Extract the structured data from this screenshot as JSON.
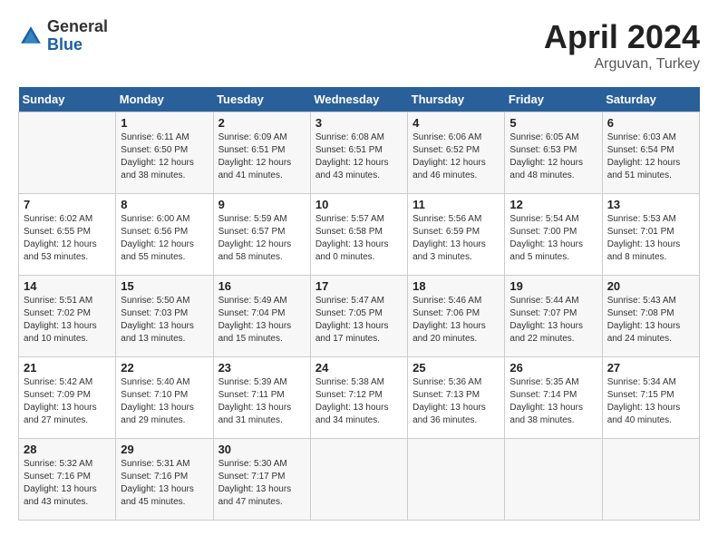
{
  "header": {
    "logo": {
      "general": "General",
      "blue": "Blue"
    },
    "title": "April 2024",
    "location": "Arguvan, Turkey"
  },
  "weekdays": [
    "Sunday",
    "Monday",
    "Tuesday",
    "Wednesday",
    "Thursday",
    "Friday",
    "Saturday"
  ],
  "weeks": [
    [
      {
        "day": "",
        "sunrise": "",
        "sunset": "",
        "daylight": ""
      },
      {
        "day": "1",
        "sunrise": "Sunrise: 6:11 AM",
        "sunset": "Sunset: 6:50 PM",
        "daylight": "Daylight: 12 hours and 38 minutes."
      },
      {
        "day": "2",
        "sunrise": "Sunrise: 6:09 AM",
        "sunset": "Sunset: 6:51 PM",
        "daylight": "Daylight: 12 hours and 41 minutes."
      },
      {
        "day": "3",
        "sunrise": "Sunrise: 6:08 AM",
        "sunset": "Sunset: 6:51 PM",
        "daylight": "Daylight: 12 hours and 43 minutes."
      },
      {
        "day": "4",
        "sunrise": "Sunrise: 6:06 AM",
        "sunset": "Sunset: 6:52 PM",
        "daylight": "Daylight: 12 hours and 46 minutes."
      },
      {
        "day": "5",
        "sunrise": "Sunrise: 6:05 AM",
        "sunset": "Sunset: 6:53 PM",
        "daylight": "Daylight: 12 hours and 48 minutes."
      },
      {
        "day": "6",
        "sunrise": "Sunrise: 6:03 AM",
        "sunset": "Sunset: 6:54 PM",
        "daylight": "Daylight: 12 hours and 51 minutes."
      }
    ],
    [
      {
        "day": "7",
        "sunrise": "Sunrise: 6:02 AM",
        "sunset": "Sunset: 6:55 PM",
        "daylight": "Daylight: 12 hours and 53 minutes."
      },
      {
        "day": "8",
        "sunrise": "Sunrise: 6:00 AM",
        "sunset": "Sunset: 6:56 PM",
        "daylight": "Daylight: 12 hours and 55 minutes."
      },
      {
        "day": "9",
        "sunrise": "Sunrise: 5:59 AM",
        "sunset": "Sunset: 6:57 PM",
        "daylight": "Daylight: 12 hours and 58 minutes."
      },
      {
        "day": "10",
        "sunrise": "Sunrise: 5:57 AM",
        "sunset": "Sunset: 6:58 PM",
        "daylight": "Daylight: 13 hours and 0 minutes."
      },
      {
        "day": "11",
        "sunrise": "Sunrise: 5:56 AM",
        "sunset": "Sunset: 6:59 PM",
        "daylight": "Daylight: 13 hours and 3 minutes."
      },
      {
        "day": "12",
        "sunrise": "Sunrise: 5:54 AM",
        "sunset": "Sunset: 7:00 PM",
        "daylight": "Daylight: 13 hours and 5 minutes."
      },
      {
        "day": "13",
        "sunrise": "Sunrise: 5:53 AM",
        "sunset": "Sunset: 7:01 PM",
        "daylight": "Daylight: 13 hours and 8 minutes."
      }
    ],
    [
      {
        "day": "14",
        "sunrise": "Sunrise: 5:51 AM",
        "sunset": "Sunset: 7:02 PM",
        "daylight": "Daylight: 13 hours and 10 minutes."
      },
      {
        "day": "15",
        "sunrise": "Sunrise: 5:50 AM",
        "sunset": "Sunset: 7:03 PM",
        "daylight": "Daylight: 13 hours and 13 minutes."
      },
      {
        "day": "16",
        "sunrise": "Sunrise: 5:49 AM",
        "sunset": "Sunset: 7:04 PM",
        "daylight": "Daylight: 13 hours and 15 minutes."
      },
      {
        "day": "17",
        "sunrise": "Sunrise: 5:47 AM",
        "sunset": "Sunset: 7:05 PM",
        "daylight": "Daylight: 13 hours and 17 minutes."
      },
      {
        "day": "18",
        "sunrise": "Sunrise: 5:46 AM",
        "sunset": "Sunset: 7:06 PM",
        "daylight": "Daylight: 13 hours and 20 minutes."
      },
      {
        "day": "19",
        "sunrise": "Sunrise: 5:44 AM",
        "sunset": "Sunset: 7:07 PM",
        "daylight": "Daylight: 13 hours and 22 minutes."
      },
      {
        "day": "20",
        "sunrise": "Sunrise: 5:43 AM",
        "sunset": "Sunset: 7:08 PM",
        "daylight": "Daylight: 13 hours and 24 minutes."
      }
    ],
    [
      {
        "day": "21",
        "sunrise": "Sunrise: 5:42 AM",
        "sunset": "Sunset: 7:09 PM",
        "daylight": "Daylight: 13 hours and 27 minutes."
      },
      {
        "day": "22",
        "sunrise": "Sunrise: 5:40 AM",
        "sunset": "Sunset: 7:10 PM",
        "daylight": "Daylight: 13 hours and 29 minutes."
      },
      {
        "day": "23",
        "sunrise": "Sunrise: 5:39 AM",
        "sunset": "Sunset: 7:11 PM",
        "daylight": "Daylight: 13 hours and 31 minutes."
      },
      {
        "day": "24",
        "sunrise": "Sunrise: 5:38 AM",
        "sunset": "Sunset: 7:12 PM",
        "daylight": "Daylight: 13 hours and 34 minutes."
      },
      {
        "day": "25",
        "sunrise": "Sunrise: 5:36 AM",
        "sunset": "Sunset: 7:13 PM",
        "daylight": "Daylight: 13 hours and 36 minutes."
      },
      {
        "day": "26",
        "sunrise": "Sunrise: 5:35 AM",
        "sunset": "Sunset: 7:14 PM",
        "daylight": "Daylight: 13 hours and 38 minutes."
      },
      {
        "day": "27",
        "sunrise": "Sunrise: 5:34 AM",
        "sunset": "Sunset: 7:15 PM",
        "daylight": "Daylight: 13 hours and 40 minutes."
      }
    ],
    [
      {
        "day": "28",
        "sunrise": "Sunrise: 5:32 AM",
        "sunset": "Sunset: 7:16 PM",
        "daylight": "Daylight: 13 hours and 43 minutes."
      },
      {
        "day": "29",
        "sunrise": "Sunrise: 5:31 AM",
        "sunset": "Sunset: 7:16 PM",
        "daylight": "Daylight: 13 hours and 45 minutes."
      },
      {
        "day": "30",
        "sunrise": "Sunrise: 5:30 AM",
        "sunset": "Sunset: 7:17 PM",
        "daylight": "Daylight: 13 hours and 47 minutes."
      },
      {
        "day": "",
        "sunrise": "",
        "sunset": "",
        "daylight": ""
      },
      {
        "day": "",
        "sunrise": "",
        "sunset": "",
        "daylight": ""
      },
      {
        "day": "",
        "sunrise": "",
        "sunset": "",
        "daylight": ""
      },
      {
        "day": "",
        "sunrise": "",
        "sunset": "",
        "daylight": ""
      }
    ]
  ]
}
